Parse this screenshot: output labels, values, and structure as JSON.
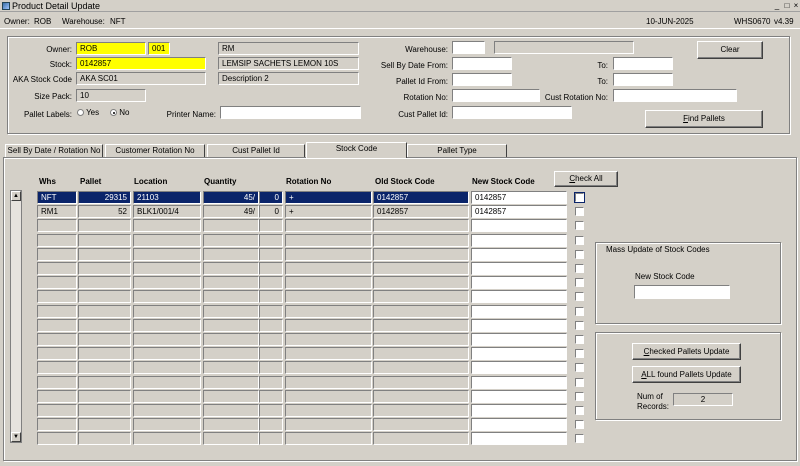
{
  "window": {
    "title": "Product Detail Update"
  },
  "status": {
    "owner_label": "Owner:",
    "owner": "ROB",
    "warehouse_label": "Warehouse:",
    "warehouse": "NFT",
    "date": "10-JUN-2025",
    "program": "WHS0670",
    "version": "v4.39"
  },
  "form": {
    "owner_label": "Owner:",
    "owner_code": "ROB",
    "owner_sub": "001",
    "owner_type": "RM",
    "stock_label": "Stock:",
    "stock": "0142857",
    "stock_desc": "LEMSIP SACHETS LEMON 10S",
    "aka_label": "AKA Stock Code",
    "aka": "AKA SC01",
    "desc2": "Description 2",
    "size_pack_label": "Size Pack:",
    "size_pack": "10",
    "pallet_labels_label": "Pallet Labels:",
    "yes_label": "Yes",
    "no_label": "No",
    "printer_label": "Printer Name:",
    "printer": "",
    "warehouse_label": "Warehouse:",
    "warehouse": "",
    "warehouse_desc": "",
    "sell_by_from_label": "Sell By Date From:",
    "sell_by_from": "",
    "to_label": "To:",
    "sell_by_to": "",
    "pallet_from_label": "Pallet Id From:",
    "pallet_from": "",
    "pallet_to": "",
    "rotation_label": "Rotation No:",
    "rotation": "",
    "cust_rotation_label": "Cust Rotation No:",
    "cust_rotation": "",
    "cust_pallet_label": "Cust Pallet Id:",
    "cust_pallet": "",
    "clear_label": "Clear",
    "find_label": "Find Pallets"
  },
  "tabs": [
    {
      "label": "Sell By Date / Rotation No"
    },
    {
      "label": "Customer Rotation No"
    },
    {
      "label": "Cust Pallet Id"
    },
    {
      "label": "Stock Code"
    },
    {
      "label": "Pallet Type"
    }
  ],
  "grid": {
    "headers": {
      "whs": "Whs",
      "pallet": "Pallet",
      "location": "Location",
      "quantity": "Quantity",
      "rotation": "Rotation No",
      "old_code": "Old Stock Code",
      "new_code": "New Stock Code"
    },
    "check_all_label": "Check All",
    "rows": [
      {
        "whs": "NFT",
        "pallet": "29315",
        "location": "21103",
        "qty_a": "45/",
        "qty_b": "0",
        "rotation": "+",
        "old_code": "0142857",
        "new_code": "0142857"
      },
      {
        "whs": "RM1",
        "pallet": "52",
        "location": "BLK1/001/4",
        "qty_a": "49/",
        "qty_b": "0",
        "rotation": "+",
        "old_code": "0142857",
        "new_code": "0142857"
      }
    ]
  },
  "mass": {
    "title": "Mass Update of Stock Codes",
    "new_code_label": "New Stock Code",
    "new_code": "",
    "checked_label": "Checked Pallets Update",
    "all_label": "ALL found Pallets Update",
    "num_label_1": "Num of",
    "num_label_2": "Records:",
    "num": "2"
  }
}
